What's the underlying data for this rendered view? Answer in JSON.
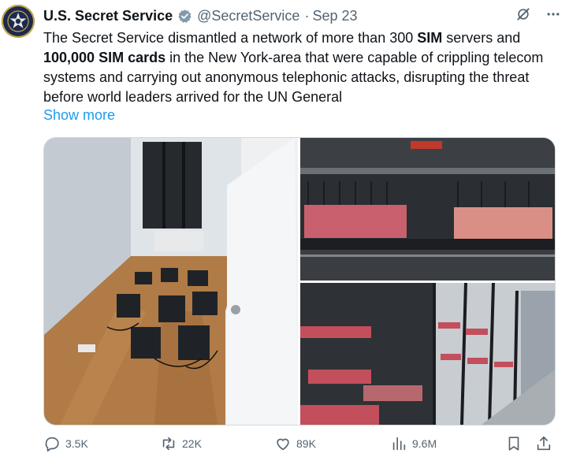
{
  "author": {
    "name": "U.S. Secret Service",
    "handle": "@SecretService",
    "separator": "·",
    "date": "Sep 23"
  },
  "tweet": {
    "parts": [
      {
        "text": "The Secret Service dismantled a network of more than 300 ",
        "bold": false
      },
      {
        "text": "SIM",
        "bold": true
      },
      {
        "text": " servers and ",
        "bold": false
      },
      {
        "text": "100,000 SIM cards",
        "bold": true
      },
      {
        "text": " in the New York-area that were capable of crippling telecom systems and carrying out anonymous telephonic attacks, disrupting the threat before world leaders arrived for the UN General",
        "bold": false
      }
    ],
    "show_more": "Show more"
  },
  "actions": {
    "replies": "3.5K",
    "reposts": "22K",
    "likes": "89K",
    "views": "9.6M"
  },
  "icons": {
    "verified": "verified-badge-icon",
    "grok": "grok-icon",
    "more": "more-icon",
    "reply": "reply-icon",
    "repost": "repost-icon",
    "like": "like-icon",
    "views": "views-icon",
    "bookmark": "bookmark-icon",
    "share": "share-icon"
  },
  "colors": {
    "text": "#0f1419",
    "secondary": "#536471",
    "link": "#1d9bf0",
    "verified": "#829aab"
  }
}
